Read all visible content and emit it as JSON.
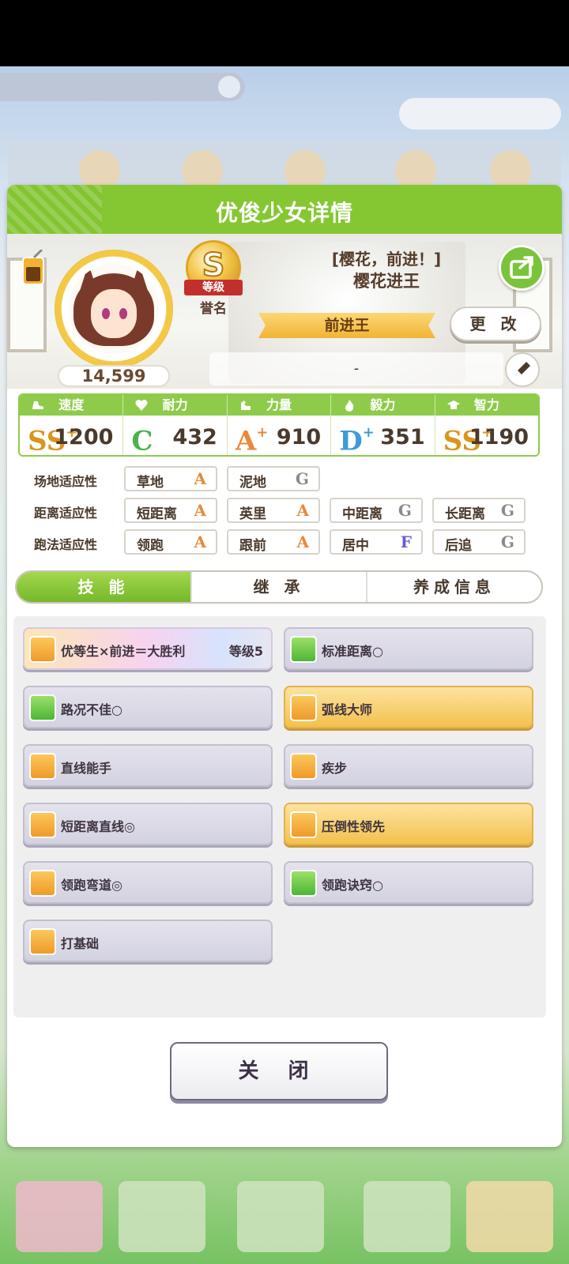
{
  "modal": {
    "title": "优俊少女详情",
    "rank_letter": "S",
    "rank_ribbon": "等级",
    "rank_name": "誉名",
    "score": "14,599",
    "epithet": "[樱花，前进！]",
    "name": "樱花进王",
    "title_ribbon": "前进王",
    "change_label": "更 改",
    "message": "-"
  },
  "stats": [
    {
      "label": "速度",
      "grade": "SS",
      "plus": "+",
      "grade_color": "#d9961c",
      "value": "1200"
    },
    {
      "label": "耐力",
      "grade": "C",
      "plus": "",
      "grade_color": "#4bb34a",
      "value": "432"
    },
    {
      "label": "力量",
      "grade": "A",
      "plus": "+",
      "grade_color": "#e8893a",
      "value": "910"
    },
    {
      "label": "毅力",
      "grade": "D",
      "plus": "+",
      "grade_color": "#3f9bd8",
      "value": "351"
    },
    {
      "label": "智力",
      "grade": "SS",
      "plus": "+",
      "grade_color": "#d9961c",
      "value": "1190"
    }
  ],
  "aptitude": {
    "surface_label": "场地适应性",
    "distance_label": "距离适应性",
    "style_label": "跑法适应性",
    "surface": [
      {
        "name": "草地",
        "grade": "A"
      },
      {
        "name": "泥地",
        "grade": "G"
      }
    ],
    "distance": [
      {
        "name": "短距离",
        "grade": "A"
      },
      {
        "name": "英里",
        "grade": "A"
      },
      {
        "name": "中距离",
        "grade": "G"
      },
      {
        "name": "长距离",
        "grade": "G"
      }
    ],
    "style": [
      {
        "name": "领跑",
        "grade": "A"
      },
      {
        "name": "跟前",
        "grade": "A"
      },
      {
        "name": "居中",
        "grade": "F"
      },
      {
        "name": "后追",
        "grade": "G"
      }
    ]
  },
  "grade_colors": {
    "A": "#e8893a",
    "G": "#8a8a8a",
    "F": "#6a5ad6"
  },
  "tabs": [
    "技 能",
    "继 承",
    "养成信息"
  ],
  "skills": [
    {
      "name": "优等生×前进＝大胜利",
      "level": "等级5",
      "style": "rainbow",
      "icon": "orange"
    },
    {
      "name": "标准距离○",
      "level": "",
      "style": "normal",
      "icon": "green"
    },
    {
      "name": "路况不佳○",
      "level": "",
      "style": "normal",
      "icon": "green"
    },
    {
      "name": "弧线大师",
      "level": "",
      "style": "gold",
      "icon": "orange"
    },
    {
      "name": "直线能手",
      "level": "",
      "style": "normal",
      "icon": "orange"
    },
    {
      "name": "疾步",
      "level": "",
      "style": "normal",
      "icon": "orange"
    },
    {
      "name": "短距离直线◎",
      "level": "",
      "style": "normal",
      "icon": "orange"
    },
    {
      "name": "压倒性领先",
      "level": "",
      "style": "gold",
      "icon": "orange"
    },
    {
      "name": "领跑弯道◎",
      "level": "",
      "style": "normal",
      "icon": "orange"
    },
    {
      "name": "领跑诀窍○",
      "level": "",
      "style": "normal",
      "icon": "green"
    },
    {
      "name": "打基础",
      "level": "",
      "style": "normal",
      "icon": "orange"
    }
  ],
  "close_label": "关 闭",
  "icons": {
    "juice": "juice-cup-icon",
    "share": "share-icon",
    "edit": "pencil-icon",
    "speed": "shoe-icon",
    "stamina": "heart-icon",
    "power": "muscle-icon",
    "guts": "flame-icon",
    "wisdom": "graduation-cap-icon",
    "skill_orange": "running-horse-icon",
    "skill_green": "skill-icon"
  }
}
